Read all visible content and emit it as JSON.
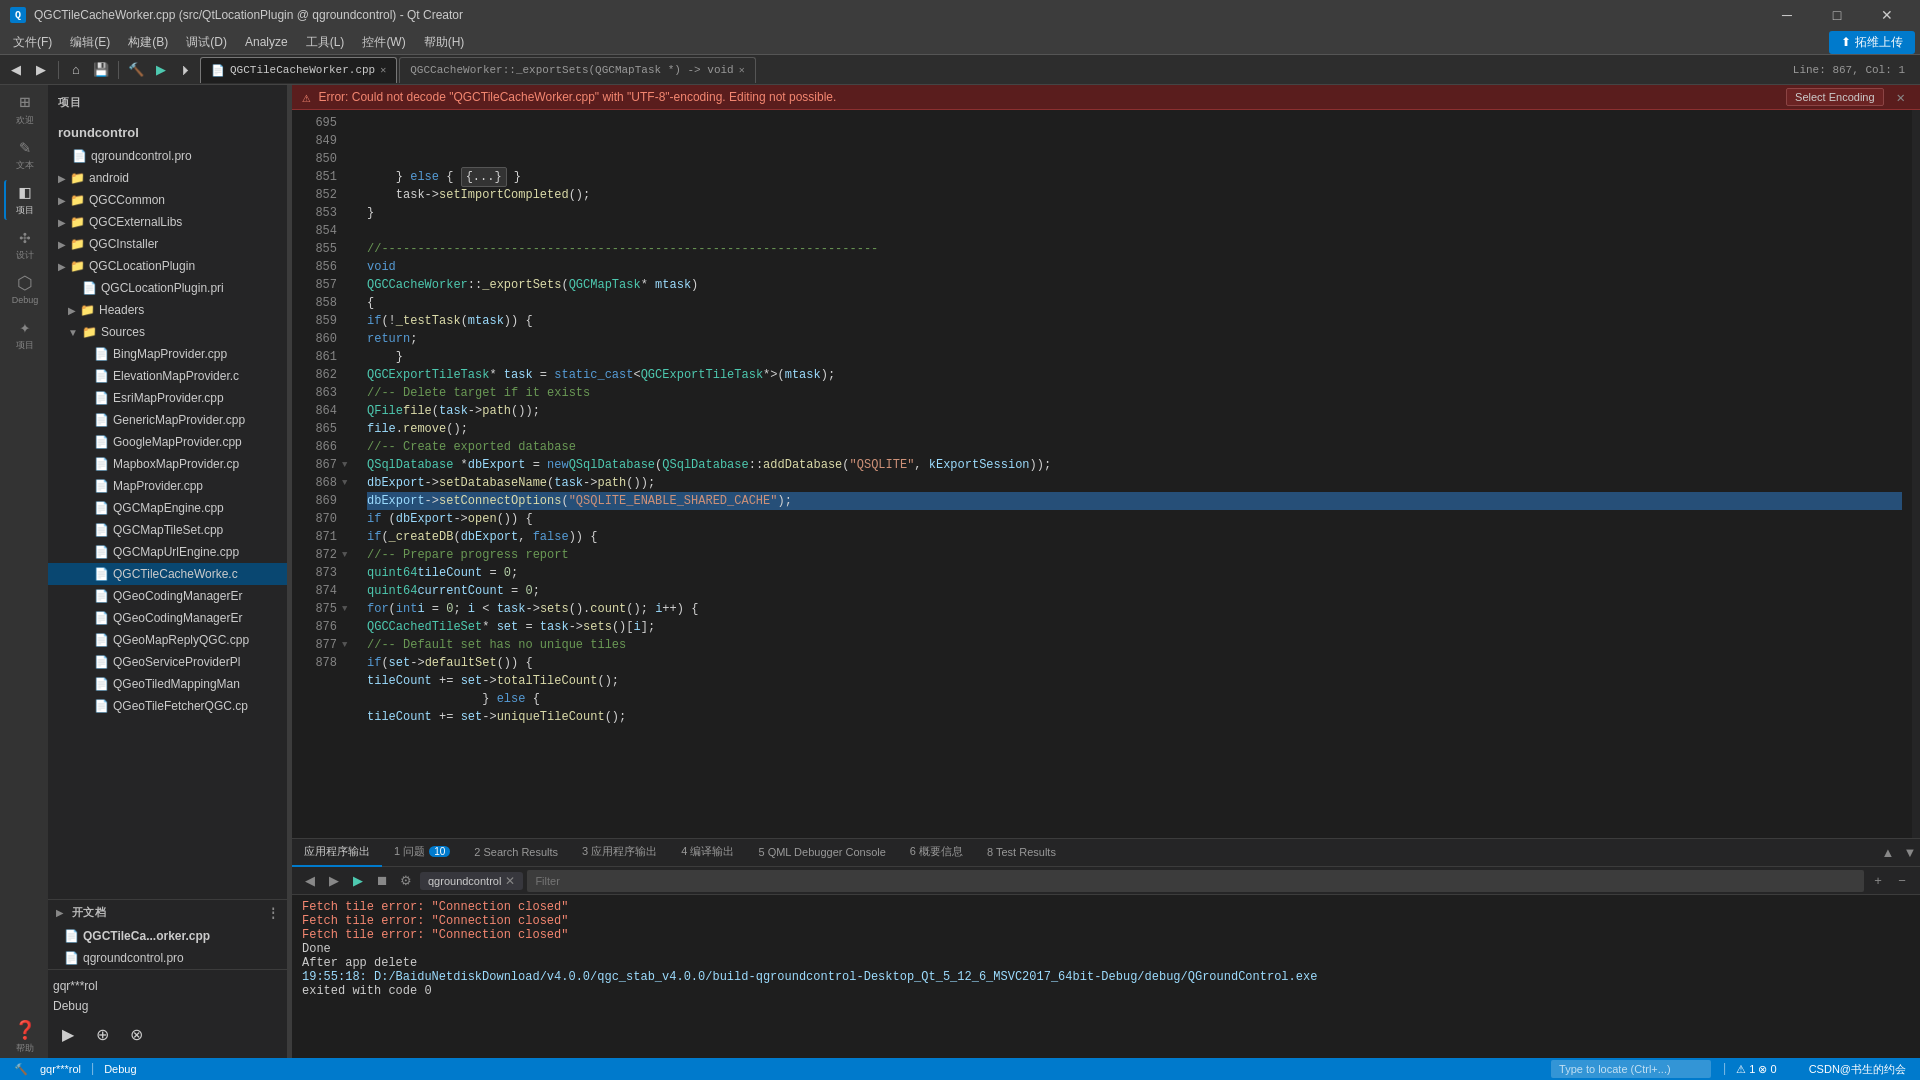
{
  "titlebar": {
    "title": "QGCTileCacheWorker.cpp (src/QtLocationPlugin @ qgroundcontrol) - Qt Creator",
    "icon": "Q",
    "min_label": "─",
    "max_label": "□",
    "close_label": "✕"
  },
  "menubar": {
    "items": [
      "文件(F)",
      "编辑(E)",
      "构建(B)",
      "调试(D)",
      "Analyze",
      "工具(L)",
      "控件(W)",
      "帮助(H)"
    ],
    "upload_label": "拓维上传"
  },
  "toolbar": {
    "back_label": "◀",
    "forward_label": "▶",
    "save_label": "💾"
  },
  "tabs": [
    {
      "label": "QGCTileCacheWorker.cpp",
      "active": true
    },
    {
      "label": "QGCCacheWorker::_exportSets(QGCMapTask *) -> void",
      "active": false
    }
  ],
  "line_info": "Line: 867, Col: 1",
  "error_bar": {
    "text": "Error: Could not decode \"QGCTileCacheWorker.cpp\" with \"UTF-8\"-encoding. Editing not possible.",
    "select_encoding_label": "Select Encoding",
    "close_label": "✕"
  },
  "sidebar": {
    "header": "项目",
    "project_name": "roundcontrol",
    "tree_items": [
      {
        "label": "qgroundcontrol.pro",
        "indent": 0,
        "icon": "pro",
        "type": "pro"
      },
      {
        "label": "android",
        "indent": 0,
        "icon": "folder",
        "type": "folder"
      },
      {
        "label": "QGCCommon",
        "indent": 0,
        "icon": "folder",
        "type": "folder"
      },
      {
        "label": "QGCExternalLibs",
        "indent": 0,
        "icon": "folder",
        "type": "folder"
      },
      {
        "label": "QGCInstaller",
        "indent": 0,
        "icon": "folder",
        "type": "folder"
      },
      {
        "label": "QGCLocationPlugin",
        "indent": 0,
        "icon": "folder",
        "type": "folder"
      },
      {
        "label": "QGCLocationPlugin.pri",
        "indent": 1,
        "icon": "pri",
        "type": "h"
      },
      {
        "label": "Headers",
        "indent": 1,
        "icon": "folder",
        "type": "folder"
      },
      {
        "label": "Sources",
        "indent": 1,
        "icon": "folder",
        "type": "folder",
        "expanded": true
      },
      {
        "label": "BingMapProvider.cpp",
        "indent": 2,
        "icon": "cpp",
        "type": "cpp"
      },
      {
        "label": "ElevationMapProvider.c",
        "indent": 2,
        "icon": "cpp",
        "type": "cpp"
      },
      {
        "label": "EsriMapProvider.cpp",
        "indent": 2,
        "icon": "cpp",
        "type": "cpp"
      },
      {
        "label": "GenericMapProvider.cpp",
        "indent": 2,
        "icon": "cpp",
        "type": "cpp"
      },
      {
        "label": "GoogleMapProvider.cpp",
        "indent": 2,
        "icon": "cpp",
        "type": "cpp"
      },
      {
        "label": "MapboxMapProvider.cp",
        "indent": 2,
        "icon": "cpp",
        "type": "cpp"
      },
      {
        "label": "MapProvider.cpp",
        "indent": 2,
        "icon": "cpp",
        "type": "cpp"
      },
      {
        "label": "QGCMapEngine.cpp",
        "indent": 2,
        "icon": "cpp",
        "type": "cpp"
      },
      {
        "label": "QGCMapTileSet.cpp",
        "indent": 2,
        "icon": "cpp",
        "type": "cpp"
      },
      {
        "label": "QGCMapUrlEngine.cpp",
        "indent": 2,
        "icon": "cpp",
        "type": "cpp"
      },
      {
        "label": "QGCTileCacheWorke.c",
        "indent": 2,
        "icon": "cpp",
        "type": "cpp",
        "selected": true
      },
      {
        "label": "QGeoCodingManagerEr",
        "indent": 2,
        "icon": "cpp",
        "type": "cpp"
      },
      {
        "label": "QGeoCodingManagerEr",
        "indent": 2,
        "icon": "cpp",
        "type": "cpp"
      },
      {
        "label": "QGeoMapReplyQGC.cpp",
        "indent": 2,
        "icon": "cpp",
        "type": "cpp"
      },
      {
        "label": "QGeoServiceProviderPl",
        "indent": 2,
        "icon": "cpp",
        "type": "cpp"
      },
      {
        "label": "QGeoTiledMappingMan",
        "indent": 2,
        "icon": "cpp",
        "type": "cpp"
      },
      {
        "label": "QGeoTileFetcherQGC.cp",
        "indent": 2,
        "icon": "cpp",
        "type": "cpp"
      }
    ],
    "open_files_label": "开文档",
    "open_files": [
      {
        "label": "QGCTileCa...orker.cpp",
        "active": true
      },
      {
        "label": "qgroundcontrol.pro",
        "active": false
      }
    ]
  },
  "activity_bar": {
    "items": [
      {
        "icon": "⊞",
        "label": "欢迎"
      },
      {
        "icon": "✎",
        "label": "文本"
      },
      {
        "icon": "◧",
        "label": "项目",
        "active": true
      },
      {
        "icon": "✣",
        "label": "设计"
      },
      {
        "icon": "⬡",
        "label": "Debug"
      },
      {
        "icon": "✦",
        "label": "项目"
      },
      {
        "icon": "❓",
        "label": "帮助"
      }
    ]
  },
  "code": {
    "lines": [
      {
        "num": "695",
        "content": "    } else { {...}"
      },
      {
        "num": "849",
        "content": "    task->setImportCompleted();"
      },
      {
        "num": "850",
        "content": "}"
      },
      {
        "num": "851",
        "content": ""
      },
      {
        "num": "852",
        "content": "//---------------------------------------------------------------------"
      },
      {
        "num": "853",
        "content": "void"
      },
      {
        "num": "854",
        "content": "QGCCacheWorker::_exportSets(QGCMapTask* mtask)"
      },
      {
        "num": "855",
        "content": "{"
      },
      {
        "num": "856",
        "content": "    if(!_testTask(mtask)) {"
      },
      {
        "num": "857",
        "content": "        return;"
      },
      {
        "num": "858",
        "content": "    }"
      },
      {
        "num": "859",
        "content": "    QGCExportTileTask* task = static_cast<QGCExportTileTask*>(mtask);"
      },
      {
        "num": "860",
        "content": "    //-- Delete target if it exists"
      },
      {
        "num": "861",
        "content": "    QFile file(task->path());"
      },
      {
        "num": "862",
        "content": "    file.remove();"
      },
      {
        "num": "863",
        "content": "    //-- Create exported database"
      },
      {
        "num": "864",
        "content": "    QSqlDatabase *dbExport = new QSqlDatabase(QSqlDatabase::addDatabase(\"QSQLITE\", kExportSession));"
      },
      {
        "num": "865",
        "content": "    dbExport->setDatabaseName(task->path());"
      },
      {
        "num": "866",
        "content": "    dbExport->setConnectOptions(\"QSQLITE_ENABLE_SHARED_CACHE\");",
        "highlighted": true
      },
      {
        "num": "867",
        "content": "    if (dbExport->open()) {",
        "folded": true
      },
      {
        "num": "868",
        "content": "        if(_createDB(dbExport, false)) {",
        "folded": true
      },
      {
        "num": "869",
        "content": "            //-- Prepare progress report"
      },
      {
        "num": "870",
        "content": "            quint64 tileCount = 0;"
      },
      {
        "num": "871",
        "content": "            quint64 currentCount = 0;"
      },
      {
        "num": "872",
        "content": "            for(int i = 0; i < task->sets().count(); i++) {",
        "folded": true
      },
      {
        "num": "873",
        "content": "                QGCCachedTileSet* set = task->sets()[i];"
      },
      {
        "num": "874",
        "content": "                //-- Default set has no unique tiles"
      },
      {
        "num": "875",
        "content": "                if(set->defaultSet()) {",
        "folded": true
      },
      {
        "num": "876",
        "content": "                    tileCount += set->totalTileCount();"
      },
      {
        "num": "877",
        "content": "                } else {",
        "folded": true
      },
      {
        "num": "878",
        "content": "                    tileCount += set->uniqueTileCount();"
      }
    ]
  },
  "bottom_panel": {
    "tabs": [
      {
        "label": "应用程序输出",
        "active": true
      },
      {
        "label": "1 问题",
        "badge": "10"
      },
      {
        "label": "2 Search Results"
      },
      {
        "label": "3 应用程序输出"
      },
      {
        "label": "4 编译输出"
      },
      {
        "label": "5 QML Debugger Console"
      },
      {
        "label": "6 概要信息"
      },
      {
        "label": "8 Test Results"
      }
    ],
    "filter_placeholder": "Filter",
    "process_tag": "qgroundcontrol",
    "log_lines": [
      {
        "text": "Fetch tile error: \"Connection closed\"",
        "type": "error"
      },
      {
        "text": "Fetch tile error: \"Connection closed\"",
        "type": "error"
      },
      {
        "text": "Fetch tile error: \"Connection closed\"",
        "type": "error"
      },
      {
        "text": "Done",
        "type": "normal"
      },
      {
        "text": "After app delete",
        "type": "normal"
      },
      {
        "text": "19:55:18: D:/BaiduNetdiskDownload/v4.0.0/qgc_stab_v4.0.0/build-qgroundcontrol-Desktop_Qt_5_12_6_MSVC2017_64bit-Debug/debug/QGroundControl.exe",
        "type": "path"
      },
      {
        "text": "exited with code 0",
        "type": "normal"
      }
    ]
  },
  "status_bar": {
    "items": [
      {
        "label": "qgr***rol"
      },
      {
        "label": "Debug"
      }
    ],
    "search_placeholder": "Type to locate (Ctrl+...)",
    "right_info": "CSDN@书生的约会",
    "controls": [
      "▲",
      "▼",
      "●",
      "▶",
      "⊕"
    ]
  },
  "debug_area": {
    "label": "gqr***rol",
    "debug_label": "Debug",
    "buttons": [
      "▶",
      "⊕",
      "⊗"
    ]
  }
}
